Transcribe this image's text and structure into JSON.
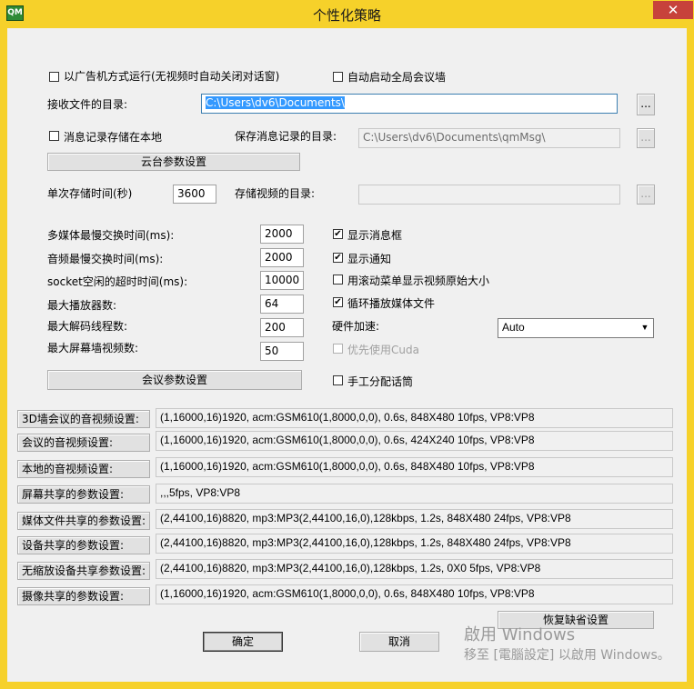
{
  "window": {
    "title": "个性化策略",
    "icon_text": "QM",
    "close_glyph": "✕"
  },
  "options": {
    "ad_mode_label": "以广告机方式运行(无视频时自动关闭对话窗)",
    "auto_wall_label": "自动启动全局会议墙",
    "receive_dir_label": "接收文件的目录:",
    "receive_dir_value": "C:\\Users\\dv6\\Documents\\",
    "browse_label": "...",
    "save_local_label": "消息记录存储在本地",
    "msg_dir_label": "保存消息记录的目录:",
    "msg_dir_value": "C:\\Users\\dv6\\Documents\\qmMsg\\",
    "ptz_button": "云台参数设置",
    "single_store_label": "单次存储时间(秒)",
    "single_store_value": "3600",
    "video_dir_label": "存储视频的目录:",
    "video_dir_value": ""
  },
  "numeric": [
    {
      "label": "多媒体最慢交换时间(ms):",
      "value": "2000"
    },
    {
      "label": "音频最慢交换时间(ms):",
      "value": "2000"
    },
    {
      "label": "socket空闲的超时时间(ms):",
      "value": "10000"
    },
    {
      "label": "最大播放器数:",
      "value": "64"
    },
    {
      "label": "最大解码线程数:",
      "value": "200"
    },
    {
      "label": "最大屏幕墙视频数:",
      "value": "50"
    }
  ],
  "toggles": [
    {
      "label": "显示消息框",
      "checked": true,
      "mark": "✔"
    },
    {
      "label": "显示通知",
      "checked": true,
      "mark": "✔"
    },
    {
      "label": "用滚动菜单显示视频原始大小",
      "checked": false,
      "mark": ""
    },
    {
      "label": "循环播放媒体文件",
      "checked": true,
      "mark": "✔"
    }
  ],
  "hw_accel": {
    "label": "硬件加速:",
    "value": "Auto",
    "arrow": "▼"
  },
  "cuda_label": "优先使用Cuda",
  "meeting_button": "会议参数设置",
  "manual_mic_label": "手工分配话筒",
  "params": [
    {
      "label": "3D墙会议的音视频设置:",
      "value": "(1,16000,16)1920, acm:GSM610(1,8000,0,0), 0.6s, 848X480 10fps, VP8:VP8"
    },
    {
      "label": "会议的音视频设置:",
      "value": "(1,16000,16)1920, acm:GSM610(1,8000,0,0), 0.6s, 424X240 10fps, VP8:VP8"
    },
    {
      "label": "本地的音视频设置:",
      "value": "(1,16000,16)1920, acm:GSM610(1,8000,0,0), 0.6s, 848X480 10fps, VP8:VP8"
    },
    {
      "label": "屏幕共享的参数设置:",
      "value": ",,,5fps, VP8:VP8"
    },
    {
      "label": "媒体文件共享的参数设置:",
      "value": "(2,44100,16)8820, mp3:MP3(2,44100,16,0),128kbps, 1.2s, 848X480 24fps, VP8:VP8"
    },
    {
      "label": "设备共享的参数设置:",
      "value": "(2,44100,16)8820, mp3:MP3(2,44100,16,0),128kbps, 1.2s, 848X480 24fps, VP8:VP8"
    },
    {
      "label": "无缩放设备共享参数设置:",
      "value": "(2,44100,16)8820, mp3:MP3(2,44100,16,0),128kbps, 1.2s, 0X0 5fps, VP8:VP8"
    },
    {
      "label": "摄像共享的参数设置:",
      "value": "(1,16000,16)1920, acm:GSM610(1,8000,0,0), 0.6s, 848X480 10fps, VP8:VP8"
    }
  ],
  "restore_button": "恢复缺省设置",
  "ok_button": "确定",
  "cancel_button": "取消",
  "watermark": {
    "line1": "啟用 Windows",
    "line2": "移至 [電腦設定] 以啟用 Windows。"
  }
}
